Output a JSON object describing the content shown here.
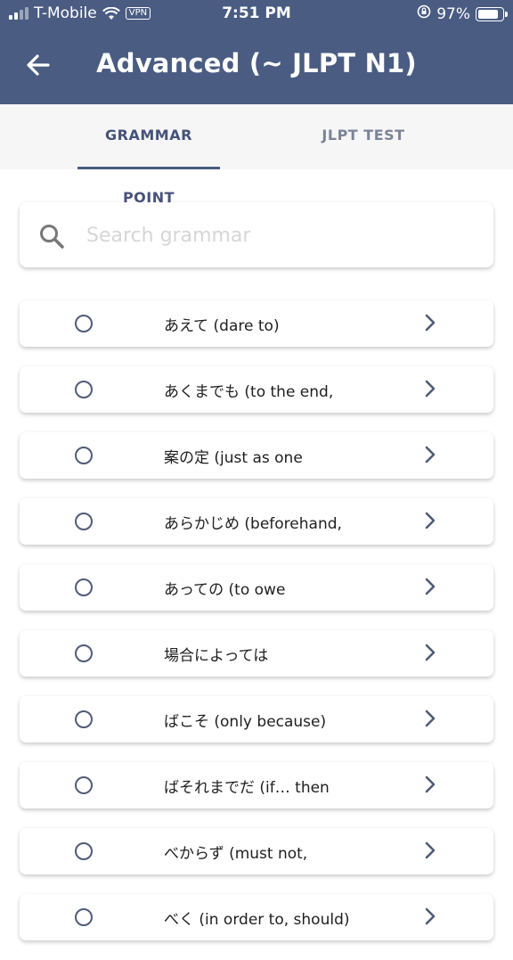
{
  "status": {
    "carrier": "T-Mobile",
    "vpn": "VPN",
    "time": "7:51 PM",
    "battery": "97%",
    "battery_level": 0.97
  },
  "header": {
    "title": "Advanced (~ JLPT N1)"
  },
  "tabs": [
    {
      "label": "GRAMMAR POINT",
      "active": true
    },
    {
      "label": "JLPT TEST",
      "active": false
    }
  ],
  "search": {
    "placeholder": "Search grammar",
    "value": ""
  },
  "items": [
    {
      "label": "あえて (dare to)"
    },
    {
      "label": "あくまでも (to the end,"
    },
    {
      "label": "案の定 (just as one"
    },
    {
      "label": "あらかじめ (beforehand,"
    },
    {
      "label": "あっての (to owe"
    },
    {
      "label": "場合によっては"
    },
    {
      "label": "ばこそ (only because)"
    },
    {
      "label": "ばそれまでだ (if… then"
    },
    {
      "label": "べからず (must not,"
    },
    {
      "label": "べく (in order to, should)"
    }
  ],
  "colors": {
    "header_bg": "#4a5c82",
    "tab_bar_bg": "#f6f6f6",
    "accent": "#4a5c82",
    "text": "#1e1e1e"
  }
}
